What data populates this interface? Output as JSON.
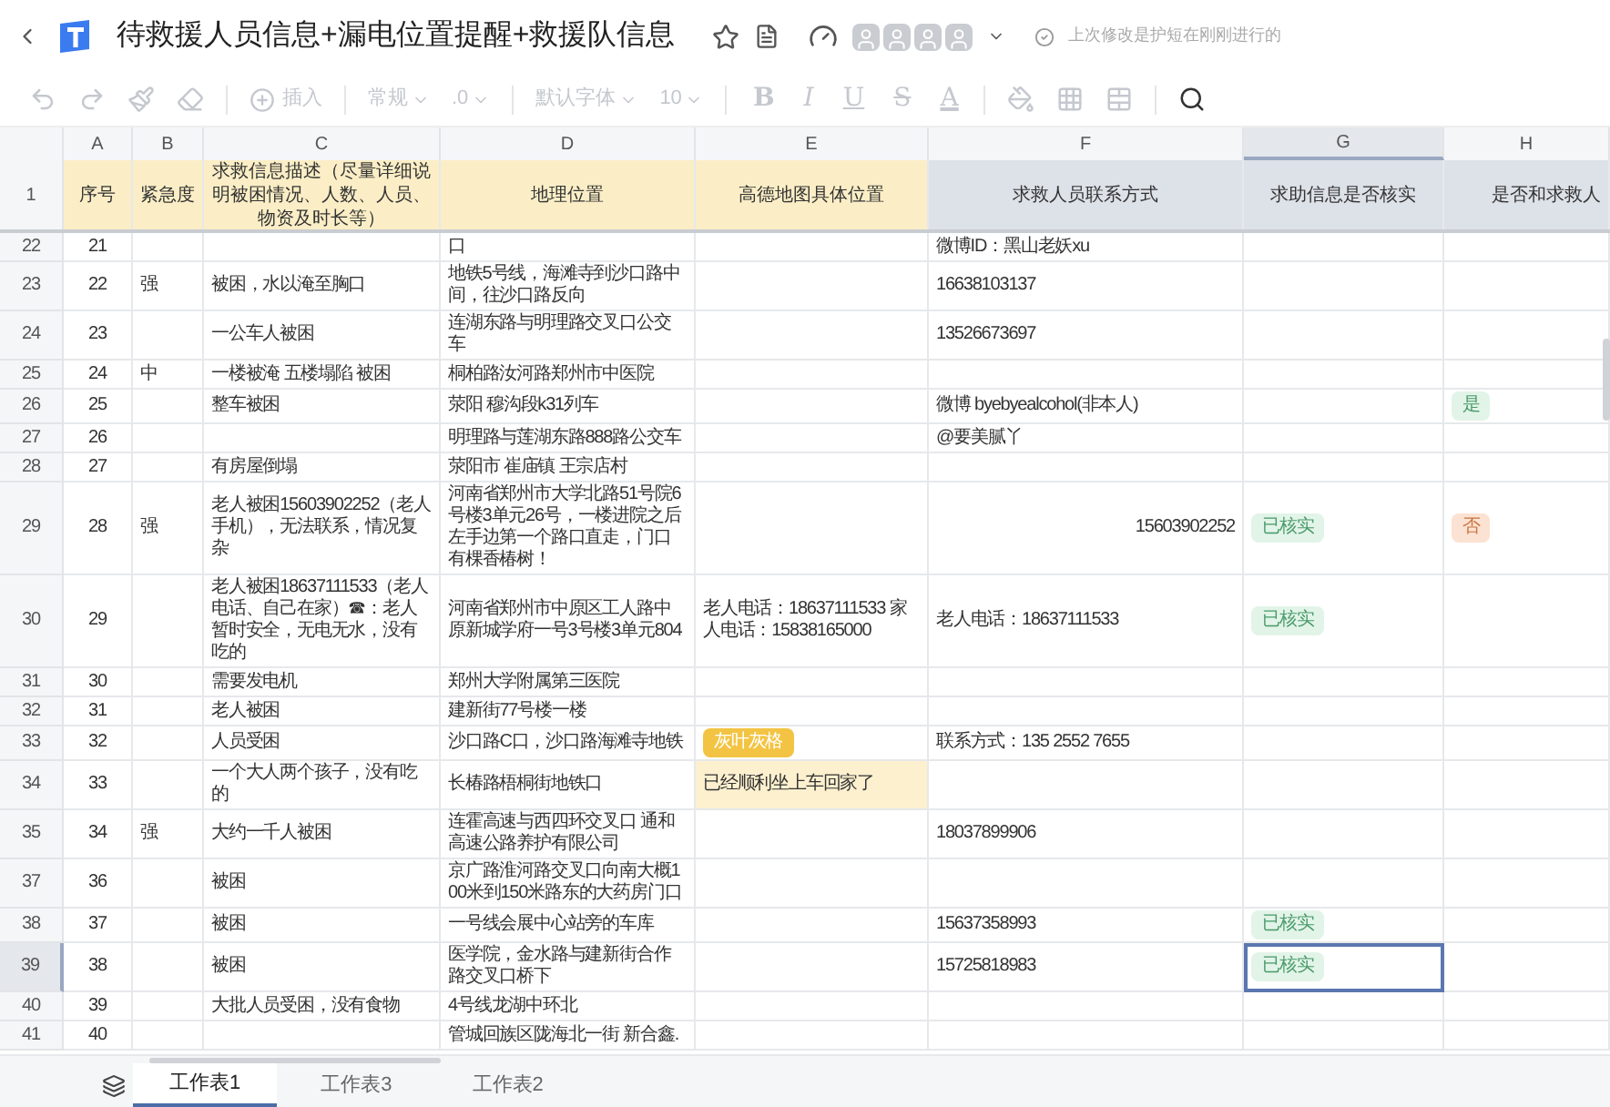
{
  "header": {
    "title": "待救援人员信息+漏电位置提醒+救援队信息",
    "status": "上次修改是护短在刚刚进行的"
  },
  "header_row": "1",
  "toolbar": [
    {
      "kind": "undo",
      "disabled": true
    },
    {
      "kind": "redo",
      "disabled": true
    },
    {
      "kind": "painter",
      "disabled": true
    },
    {
      "kind": "eraser",
      "disabled": true
    },
    {
      "kind": "sep"
    },
    {
      "kind": "insert",
      "label": "插入",
      "disabled": true
    },
    {
      "kind": "sep"
    },
    {
      "kind": "dropdown",
      "label": "常规",
      "disabled": true
    },
    {
      "kind": "dropdown",
      "label": ".0",
      "disabled": true
    },
    {
      "kind": "sep"
    },
    {
      "kind": "dropdown",
      "label": "默认字体",
      "disabled": true
    },
    {
      "kind": "dropdown",
      "label": "10",
      "disabled": true
    },
    {
      "kind": "sep"
    },
    {
      "kind": "bold",
      "label": "B",
      "disabled": true
    },
    {
      "kind": "italic",
      "label": "I",
      "disabled": true
    },
    {
      "kind": "underline",
      "label": "U",
      "disabled": true
    },
    {
      "kind": "strike",
      "label": "S",
      "disabled": true
    },
    {
      "kind": "textcolor",
      "label": "A",
      "disabled": true
    },
    {
      "kind": "sep"
    },
    {
      "kind": "fill",
      "disabled": true
    },
    {
      "kind": "border",
      "disabled": true
    },
    {
      "kind": "merge",
      "disabled": true
    },
    {
      "kind": "sep"
    },
    {
      "kind": "search",
      "disabled": false
    }
  ],
  "columns": [
    {
      "letter": "A",
      "title": "序号",
      "color": "#fbeec6",
      "selected": false
    },
    {
      "letter": "B",
      "title": "紧急度",
      "color": "#fbeec6",
      "selected": false
    },
    {
      "letter": "C",
      "title": "求救信息描述（尽量详细说明被困情况、人数、人员、物资及时长等）",
      "color": "#fbeec6",
      "selected": false
    },
    {
      "letter": "D",
      "title": "地理位置",
      "color": "#fbeec6",
      "selected": false
    },
    {
      "letter": "E",
      "title": "高德地图具体位置",
      "color": "#fbeec6",
      "selected": false
    },
    {
      "letter": "F",
      "title": "求救人员联系方式",
      "color": "#dde1e8",
      "selected": false
    },
    {
      "letter": "G",
      "title": "求助信息是否核实",
      "color": "#dde1e8",
      "selected": true
    },
    {
      "letter": "H",
      "title": "是否和求救人",
      "color": "#dde1e8",
      "selected": false
    }
  ],
  "rows": [
    {
      "row": "22",
      "selected": false,
      "cells": {
        "A": "21",
        "D": "口",
        "F": "微博ID：黑山老妖xu"
      }
    },
    {
      "row": "23",
      "selected": false,
      "cells": {
        "A": "22",
        "B": "强",
        "C": "被困，水以淹至胸口",
        "D": "地铁5号线，海滩寺到沙口路中间，往沙口路反向",
        "F": "16638103137"
      }
    },
    {
      "row": "24",
      "selected": false,
      "cells": {
        "A": "23",
        "C": "一公车人被困",
        "D": "连湖东路与明理路交叉口公交车",
        "F": "13526673697"
      }
    },
    {
      "row": "25",
      "selected": false,
      "cells": {
        "A": "24",
        "B": "中",
        "C": "一楼被淹 五楼塌陷 被困",
        "D": "桐柏路汝河路郑州市中医院"
      }
    },
    {
      "row": "26",
      "selected": false,
      "cells": {
        "A": "25",
        "C": "整车被困",
        "D": "荥阳 穆沟段k31列车",
        "F": "微博  byebyealcohol(非本人)",
        "H": {
          "kind": "tag",
          "text": "是",
          "color": "#e2f4e8"
        }
      }
    },
    {
      "row": "27",
      "selected": false,
      "cells": {
        "A": "26",
        "D": "明理路与莲湖东路888路公交车",
        "F": "@要美腻丫"
      }
    },
    {
      "row": "28",
      "selected": false,
      "cells": {
        "A": "27",
        "C": "有房屋倒塌",
        "D": "荥阳市 崔庙镇 王宗店村"
      }
    },
    {
      "row": "29",
      "selected": false,
      "cells": {
        "A": "28",
        "B": "强",
        "C": "老人被困15603902252（老人手机），无法联系，情况复杂",
        "D": "河南省郑州市大学北路51号院6号楼3单元26号，一楼进院之后左手边第一个路口直走，门口有棵香椿树！",
        "F": {
          "kind": "number",
          "text": "15603902252"
        },
        "G": {
          "kind": "tag",
          "text": "已核实",
          "color": "#e2f4e8"
        },
        "H": {
          "kind": "tag",
          "text": "否",
          "color": "#fbe2d3"
        }
      }
    },
    {
      "row": "30",
      "selected": false,
      "cells": {
        "A": "29",
        "C": "老人被困18637111533（老人电话、自己在家）☎：老人暂时安全，无电无水，没有吃的",
        "D": "河南省郑州市中原区工人路中原新城学府一号3号楼3单元804",
        "E": "老人电话：18637111533 家人电话：15838165000",
        "F": "老人电话：18637111533",
        "G": {
          "kind": "tag",
          "text": "已核实",
          "color": "#e2f4e8"
        }
      }
    },
    {
      "row": "31",
      "selected": false,
      "cells": {
        "A": "30",
        "C": "需要发电机",
        "D": "郑州大学附属第三医院"
      }
    },
    {
      "row": "32",
      "selected": false,
      "cells": {
        "A": "31",
        "C": "老人被困",
        "D": "建新街77号楼一楼"
      }
    },
    {
      "row": "33",
      "selected": false,
      "cells": {
        "A": "32",
        "C": "人员受困",
        "D": "沙口路C口，沙口路海滩寺地铁",
        "E": {
          "kind": "tag",
          "text": "灰叶灰格",
          "color": "#f3c443"
        },
        "F": "联系方式：135 2552 7655"
      }
    },
    {
      "row": "34",
      "selected": false,
      "cells": {
        "A": "33",
        "C": "一个大人两个孩子，没有吃的",
        "D": "长椿路梧桐街地铁口",
        "E": {
          "kind": "highlight",
          "text": "已经顺利坐上车回家了",
          "color": "#fdf0cf"
        }
      }
    },
    {
      "row": "35",
      "selected": false,
      "cells": {
        "A": "34",
        "B": "强",
        "C": "大约一千人被困",
        "D": "连霍高速与西四环交叉口 通和高速公路养护有限公司",
        "F": "18037899906"
      }
    },
    {
      "row": "37",
      "selected": false,
      "cells": {
        "A": "36",
        "C": "被困",
        "D": "京广路淮河路交叉口向南大概100米到150米路东的大药房门口"
      }
    },
    {
      "row": "38",
      "selected": false,
      "cells": {
        "A": "37",
        "C": "被困",
        "D": "一号线会展中心站旁的车库",
        "F": "15637358993",
        "G": {
          "kind": "tag",
          "text": "已核实",
          "color": "#e2f4e8"
        }
      }
    },
    {
      "row": "39",
      "selected": true,
      "cells": {
        "A": "38",
        "C": "被困",
        "D": "医学院，金水路与建新街合作路交叉口桥下",
        "F": "15725818983",
        "G": {
          "kind": "tag",
          "text": "已核实",
          "color": "#e2f4e8"
        }
      }
    },
    {
      "row": "40",
      "selected": false,
      "cells": {
        "A": "39",
        "C": "大批人员受困，没有食物",
        "D": "4号线龙湖中环北"
      }
    },
    {
      "row": "41",
      "selected": false,
      "cells": {
        "A": "40",
        "D": "管城回族区陇海北一街 新合鑫."
      }
    }
  ],
  "sheets": [
    {
      "label": "工作表1",
      "selected": true
    },
    {
      "label": "工作表3",
      "selected": false
    },
    {
      "label": "工作表2",
      "selected": false
    }
  ]
}
